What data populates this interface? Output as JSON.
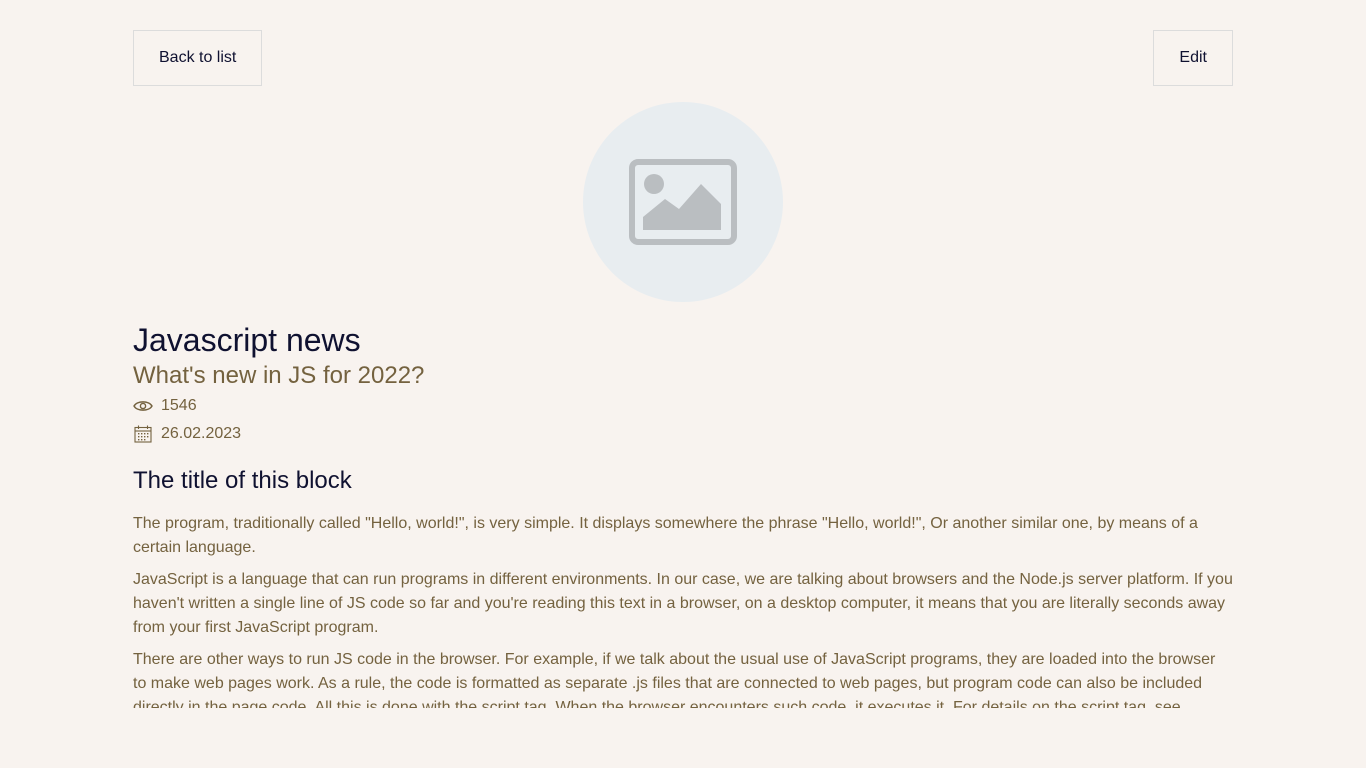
{
  "toolbar": {
    "back_label": "Back to list",
    "edit_label": "Edit"
  },
  "article": {
    "image_icon": "image-placeholder-icon",
    "title": "Javascript news",
    "subtitle": "What's new in JS for 2022?",
    "views": "1546",
    "date": "26.02.2023",
    "block_title": "The title of this block",
    "paragraphs": [
      "The program, traditionally called \"Hello, world!\", is very simple. It displays somewhere the phrase \"Hello, world!\", Or another similar one, by means of a certain language.",
      "JavaScript is a language that can run programs in different environments. In our case, we are talking about browsers and the Node.js server platform. If you haven't written a single line of JS code so far and you're reading this text in a browser, on a desktop computer, it means that you are literally seconds away from your first JavaScript program.",
      "There are other ways to run JS code in the browser. For example, if we talk about the usual use of JavaScript programs, they are loaded into the browser to make web pages work. As a rule, the code is formatted as separate .js files that are connected to web pages, but program code can also be included directly in the page code. All this is done with the script tag. When the browser encounters such code, it executes it. For details on the script tag, see"
    ]
  },
  "icons": {
    "views": "eye-icon",
    "date": "calendar-icon"
  },
  "colors": {
    "background": "#f8f3ef",
    "heading": "#0f1130",
    "body_text": "#74623f",
    "avatar_bg": "#e8edf0",
    "placeholder_icon": "#babec1"
  }
}
